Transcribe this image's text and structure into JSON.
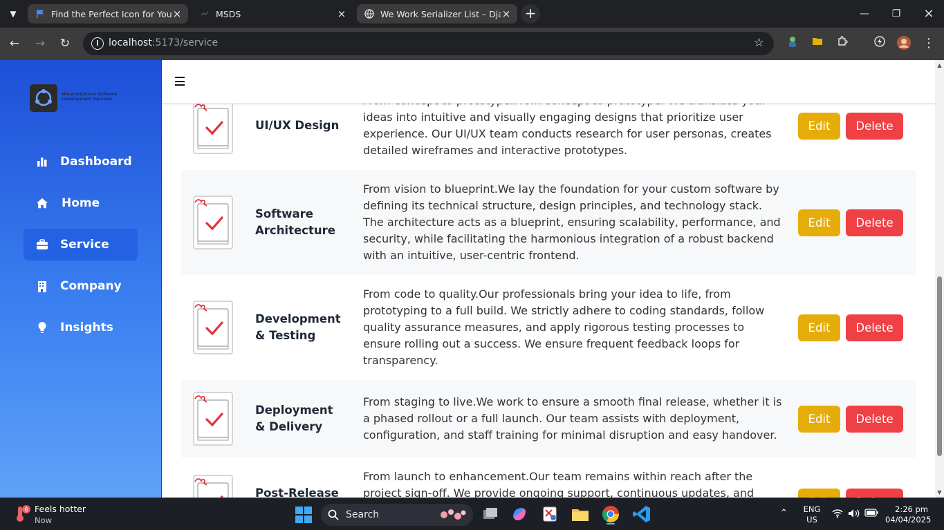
{
  "browser": {
    "tabs": [
      {
        "title": "Find the Perfect Icon for Your Pr",
        "active": true
      },
      {
        "title": "MSDS",
        "active": false
      },
      {
        "title": "We Work Serializer List – Django",
        "active": false
      }
    ],
    "url_host": "localhost",
    "url_path": ":5173/service"
  },
  "sidebar": {
    "logo_text": "Metamorphosis Software Development Services",
    "items": [
      {
        "label": "Dashboard",
        "icon": "chart-bar-icon"
      },
      {
        "label": "Home",
        "icon": "home-icon"
      },
      {
        "label": "Service",
        "icon": "briefcase-icon",
        "active": true
      },
      {
        "label": "Company",
        "icon": "building-icon"
      },
      {
        "label": "Insights",
        "icon": "lightbulb-icon"
      }
    ]
  },
  "services": [
    {
      "name": "UI/UX Design",
      "description": "From concept to prototype.From concept to prototype. We translate your ideas into intuitive and visually engaging designs that prioritize user experience. Our UI/UX team conducts research for user personas, creates detailed wireframes and interactive prototypes.",
      "edit": "Edit",
      "delete": "Delete"
    },
    {
      "name": "Software Architecture",
      "description": "From vision to blueprint.We lay the foundation for your custom software by defining its technical structure, design principles, and technology stack. The architecture acts as a blueprint, ensuring scalability, performance, and security, while facilitating the harmonious integration of a robust backend with an intuitive, user-centric frontend.",
      "edit": "Edit",
      "delete": "Delete"
    },
    {
      "name": "Development & Testing",
      "description": "From code to quality.Our professionals bring your idea to life, from prototyping to a full build. We strictly adhere to coding standards, follow quality assurance measures, and apply rigorous testing processes to ensure rolling out a success. We ensure frequent feedback loops for transparency.",
      "edit": "Edit",
      "delete": "Delete"
    },
    {
      "name": "Deployment & Delivery",
      "description": "From staging to live.We work to ensure a smooth final release, whether it is a phased rollout or a full launch. Our team assists with deployment, configuration, and staff training for minimal disruption and easy handover.",
      "edit": "Edit",
      "delete": "Delete"
    },
    {
      "name": "Post-Release & Support",
      "description": "From launch to enhancement.Our team remains within reach after the project sign-off. We provide ongoing support, continuous updates, and",
      "edit": "Edit",
      "delete": "Delete"
    }
  ],
  "taskbar": {
    "weather_badge": "6",
    "weather_title": "Feels hotter",
    "weather_sub": "Now",
    "search_placeholder": "Search",
    "lang_line1": "ENG",
    "lang_line2": "US",
    "time": "2:26 pm",
    "date": "04/04/2025"
  },
  "colors": {
    "edit": "#e6ad0a",
    "delete": "#ee4045",
    "sidebar_top": "#1d4fd8",
    "sidebar_bottom": "#5ea2f9"
  }
}
